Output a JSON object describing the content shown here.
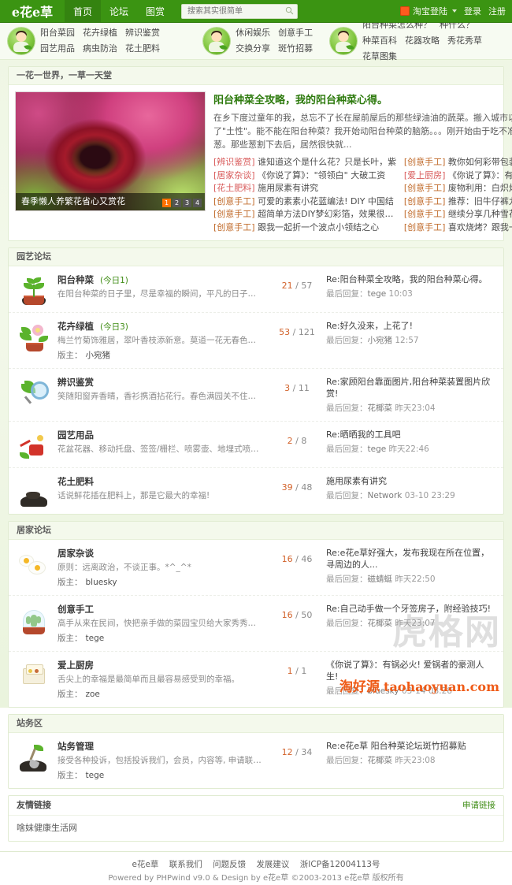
{
  "site": {
    "logo_text": "e花e草",
    "slogan": "一花一世界，一草一天堂"
  },
  "topnav": {
    "items": [
      {
        "label": "首页",
        "active": true
      },
      {
        "label": "论坛",
        "active": false
      },
      {
        "label": "图赏",
        "active": false
      }
    ],
    "search_placeholder": "搜索其实很简单",
    "search_value": "",
    "search_icon": "search-icon",
    "taobao_label": "淘宝登陆",
    "login_label": "登录",
    "register_label": "注册"
  },
  "categories": [
    {
      "mascot": "mascot-gardener",
      "links": [
        "阳台菜园",
        "花卉绿植",
        "辨识鉴赏",
        "园艺用品",
        "病虫防治",
        "花土肥料"
      ]
    },
    {
      "mascot": "mascot-leisure",
      "links": [
        "休闲娱乐",
        "创意手工",
        "交换分享",
        "斑竹招募"
      ]
    },
    {
      "mascot": "mascot-guide",
      "links": [
        "阳台种菜怎么种？",
        "种什么？",
        "种菜百科",
        "花器攻略",
        "秀花秀草",
        "花草图集"
      ]
    }
  ],
  "feature": {
    "image_caption": "春季懒人养繁花省心又赏花",
    "pager": [
      "1",
      "2",
      "3",
      "4"
    ],
    "pager_active": "1",
    "title": "阳台种菜全攻略，我的阳台种菜心得。",
    "body": "在乡下度过童年的我，总忘不了长在屋前屋后的那些绿油油的蔬菜。搬入城市以后，一直改不了\"土性\"。能不能在阳台种菜？我开始动阳台种菜的脑筋。。。刚开始由于吃不准，我只种了几盆葱。那些葱割下去后，居然很快就...",
    "left_links": [
      {
        "tag": "[辨识鉴赏]",
        "text": "谁知道这个是什么花？只是长叶，紫"
      },
      {
        "tag": "[居家杂谈]",
        "text": "《你说了算》：\"领领白\" 大破工资"
      },
      {
        "tag": "[花土肥料]",
        "text": "施用尿素有讲究"
      },
      {
        "tag": "[创意手工]",
        "text": "可爱的素素小花蓝编法! DIY 中国结"
      },
      {
        "tag": "[创意手工]",
        "text": "超简单方法DIY梦幻彩箔，效果很棒。"
      },
      {
        "tag": "[创意手工]",
        "text": "跟我一起折一个波点小领结之心"
      }
    ],
    "right_links": [
      {
        "tag": "[创意手工]",
        "text": "教你如何彩带包装礼品盒"
      },
      {
        "tag": "[爱上厨房]",
        "text": "《你说了算》：有锅必火! 爱锅者的"
      },
      {
        "tag": "[创意手工]",
        "text": "废物利用：白炽灯泡的美轮世界!~"
      },
      {
        "tag": "[创意手工]",
        "text": "推荐：旧牛仔裤九个环保处理法，超"
      },
      {
        "tag": "[创意手工]",
        "text": "继续分享几种雪花手工剪纸"
      },
      {
        "tag": "[创意手工]",
        "text": "喜欢烧烤？跟我一起利用废油桶改造"
      }
    ]
  },
  "sections": [
    {
      "title": "园艺论坛",
      "rows": [
        {
          "icon": "plant-pot-icon",
          "name": "阳台种菜",
          "today": "(今日1)",
          "desc": "在阳台种菜的日子里，尽是幸福的瞬间，平凡的日子有了甜蜜的期盼...",
          "moderator_label": "",
          "moderator": "",
          "threads": "21",
          "posts": "57",
          "last_title": "Re:阳台种菜全攻略，我的阳台种菜心得。",
          "last_prefix": "最后回复：",
          "last_user": "tege",
          "last_time": "10:03"
        },
        {
          "icon": "flower-pot-icon",
          "name": "花卉绿植",
          "today": "(今日3)",
          "desc": "梅兰竹菊饰雅居，翠叶香枝添新意。莫道一花无春色，绿染满眼皆情趣。",
          "moderator_label": "版主：",
          "moderator": "小宛猪",
          "threads": "53",
          "posts": "121",
          "last_title": "Re:好久没来，上花了!",
          "last_prefix": "最后回复：",
          "last_user": "小宛猪",
          "last_time": "12:57"
        },
        {
          "icon": "magnifier-leaf-icon",
          "name": "辨识鉴赏",
          "today": "",
          "desc": "笑随阳窗弄香晴，香衫携酒拈花行。春色满园关不住，一支红杏出墙来。",
          "moderator_label": "",
          "moderator": "",
          "threads": "3",
          "posts": "11",
          "last_title": "Re:家顾阳台靠面图片,阳台种菜装置图片欣赏!",
          "last_prefix": "最后回复：",
          "last_user": "花椰菜",
          "last_time": "昨天23:04"
        },
        {
          "icon": "watering-can-icon",
          "name": "园艺用品",
          "today": "",
          "desc": "花盆花器、移动托盘、签签/栅栏、喷雾壶、地埋式喷头、散喷/渗灌/滴头、育苗盘/营养钵...",
          "moderator_label": "",
          "moderator": "",
          "threads": "2",
          "posts": "8",
          "last_title": "Re:晒晒我的工具吧",
          "last_prefix": "最后回复：",
          "last_user": "tege",
          "last_time": "昨天22:46"
        },
        {
          "icon": "soil-icon",
          "name": "花土肥料",
          "today": "",
          "desc": "话说鲜花插在肥料上，那是它最大的幸福!",
          "moderator_label": "",
          "moderator": "",
          "threads": "39",
          "posts": "48",
          "last_title": "施用尿素有讲究",
          "last_prefix": "最后回复：",
          "last_user": "Network",
          "last_time": "03-10 23:29"
        }
      ]
    },
    {
      "title": "居家论坛",
      "rows": [
        {
          "icon": "fried-egg-icon",
          "name": "居家杂谈",
          "today": "",
          "desc": "原则：远离政治，不谈正事。*^_^*",
          "moderator_label": "版主：",
          "moderator": "bluesky",
          "threads": "16",
          "posts": "46",
          "last_title": "Re:e花e草好强大，发布我现在所在位置，寻周边的人...",
          "last_prefix": "最后回复：",
          "last_user": "磁蜻蜓",
          "last_time": "昨天22:50"
        },
        {
          "icon": "cactus-dome-icon",
          "name": "创意手工",
          "today": "",
          "desc": "高手从来在民间，快把亲手做的菜园宝贝给大家秀秀吧~~",
          "moderator_label": "版主：",
          "moderator": "tege",
          "threads": "16",
          "posts": "50",
          "last_title": "Re:自己动手做一个牙签房子，附经验技巧!",
          "last_prefix": "最后回复：",
          "last_user": "花椰菜",
          "last_time": "昨天23:07"
        },
        {
          "icon": "kitchen-box-icon",
          "name": "爱上厨房",
          "today": "",
          "desc": "舌尖上的幸福是最简单而且最容易感受到的幸福。",
          "moderator_label": "版主：",
          "moderator": "zoe",
          "threads": "1",
          "posts": "1",
          "last_title": "《你说了算》：有锅必火! 爱锅者的豪测人生!",
          "last_prefix": "最后回复：",
          "last_user": "bluesky",
          "last_time": "03-14 08:28"
        }
      ]
    },
    {
      "title": "站务区",
      "rows": [
        {
          "icon": "shovel-soil-icon",
          "name": "站务管理",
          "today": "",
          "desc": "接受各种投诉，包括投诉我们，会员，内容等, 申请联盟论坛等。",
          "moderator_label": "版主：",
          "moderator": "tege",
          "threads": "12",
          "posts": "34",
          "last_title": "Re:e花e草 阳台种菜论坛斑竹招募贴",
          "last_prefix": "最后回复：",
          "last_user": "花椰菜",
          "last_time": "昨天23:08"
        }
      ]
    }
  ],
  "friendlinks": {
    "title": "友情链接",
    "apply": "申请链接",
    "items": [
      "啥妹健康生活网"
    ]
  },
  "footer": {
    "links": [
      "e花e草",
      "联系我们",
      "问题反馈",
      "发展建议",
      "浙ICP备12004113号"
    ],
    "powered": "Powered by PHPwind v9.0 & Design by  e花e草  ©2003-2013 e花e草 版权所有"
  },
  "watermarks": {
    "big": "虎格网",
    "brand_cn": "淘好源",
    "brand_en": "taohaoyuan.com"
  },
  "colors": {
    "brand_green": "#3b9412",
    "accent_orange": "#ff7200",
    "count_orange": "#d2622a",
    "tag_red": "#d85a5a"
  }
}
